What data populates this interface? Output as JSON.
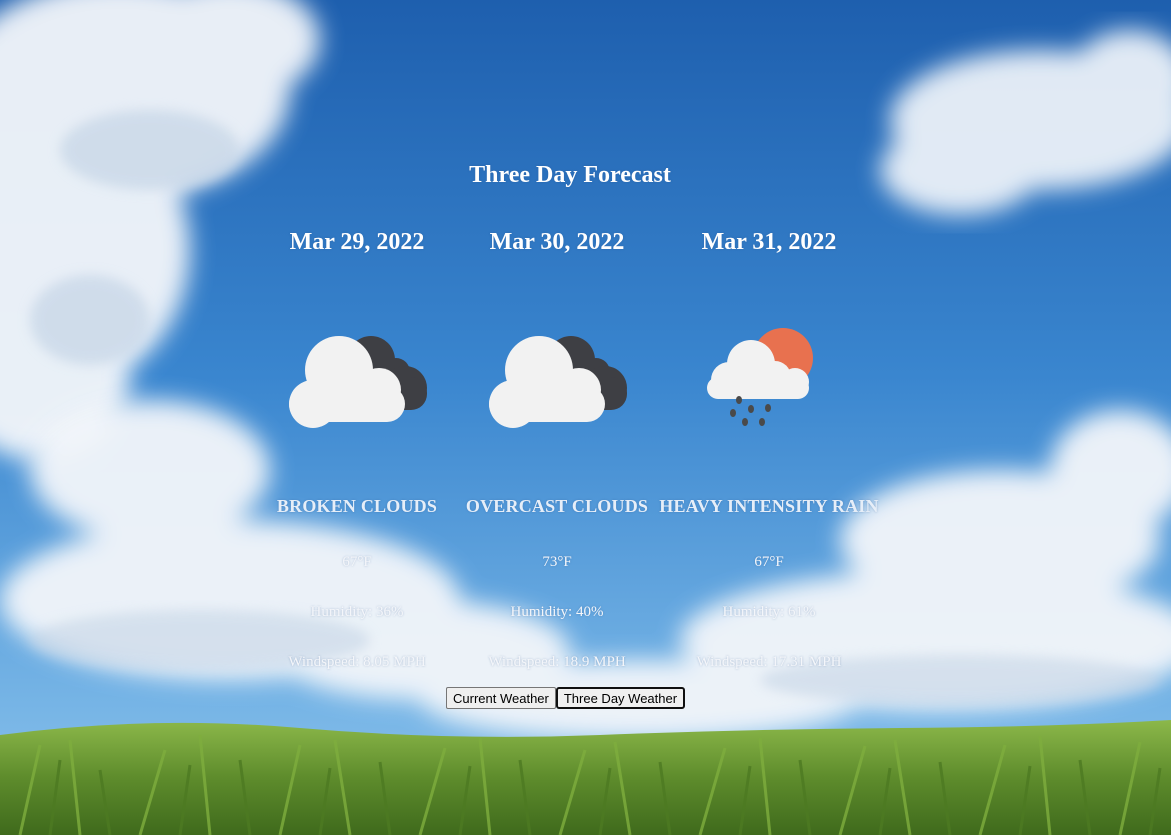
{
  "page": {
    "title": "Three Day Forecast"
  },
  "colors": {
    "sky_top": "#1f64b4",
    "sky_mid": "#3f8ad2",
    "sky_low": "#6fb0e6",
    "grass": "#5c8a2a",
    "cloud_light": "#f2f2f2",
    "cloud_dark": "#3e3f44",
    "sun": "#e8714f",
    "rain": "#4a4a4a"
  },
  "forecast": [
    {
      "date": "Mar 29, 2022",
      "icon": "broken-clouds-icon",
      "description": "BROKEN CLOUDS",
      "temperature": "67°F",
      "humidity": "Humidity: 36%",
      "wind": "Windspeed: 8.05 MPH"
    },
    {
      "date": "Mar 30, 2022",
      "icon": "overcast-clouds-icon",
      "description": "OVERCAST CLOUDS",
      "temperature": "73°F",
      "humidity": "Humidity: 40%",
      "wind": "Windspeed: 18.9 MPH"
    },
    {
      "date": "Mar 31, 2022",
      "icon": "heavy-rain-icon",
      "description": "HEAVY INTENSITY RAIN",
      "temperature": "67°F",
      "humidity": "Humidity: 61%",
      "wind": "Windspeed: 17.31 MPH"
    }
  ],
  "buttons": {
    "current_label": "Current Weather",
    "three_day_label": "Three Day Weather"
  }
}
